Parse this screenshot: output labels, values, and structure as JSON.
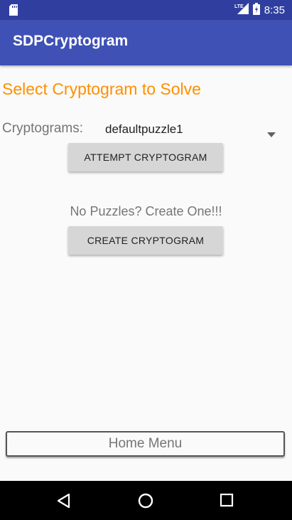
{
  "status_bar": {
    "time": "8:35",
    "network": "LTE",
    "icons": [
      "sd-card-icon",
      "lte-signal-icon",
      "battery-icon"
    ]
  },
  "app_bar": {
    "title": "SDPCryptogram"
  },
  "main": {
    "heading": "Select Cryptogram to Solve",
    "cryptograms_label": "Cryptograms:",
    "selected_puzzle": "defaultpuzzle1",
    "attempt_button": "ATTEMPT CRYPTOGRAM",
    "no_puzzles_text": "No Puzzles? Create One!!!",
    "create_button": "CREATE CRYPTOGRAM"
  },
  "footer": {
    "home_button": "Home Menu"
  },
  "colors": {
    "status_bar": "#303F9F",
    "app_bar": "#3F51B5",
    "heading": "#FF8F00",
    "button": "#D6D6D6"
  },
  "nav_bar": {
    "icons": [
      "back-icon",
      "home-icon",
      "recents-icon"
    ]
  }
}
